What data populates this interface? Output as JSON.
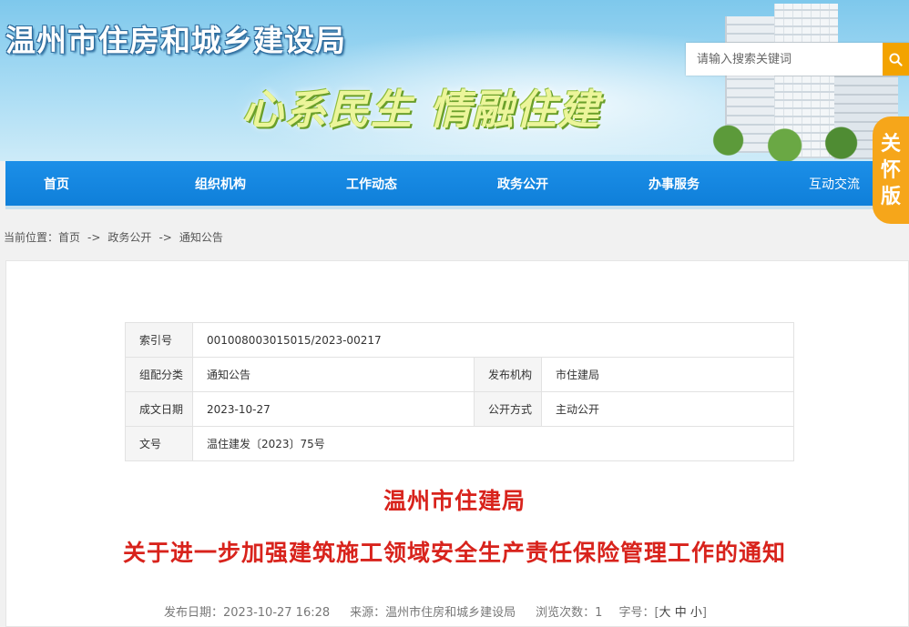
{
  "header": {
    "site_title": "温州市住房和城乡建设局",
    "slogan": "心系民生 情融住建"
  },
  "search": {
    "placeholder": "请输入搜索关键词",
    "button_icon": "search-icon"
  },
  "care_mode": {
    "label_chars": [
      "关",
      "怀",
      "版"
    ]
  },
  "nav": {
    "items": [
      {
        "label": "首页"
      },
      {
        "label": "组织机构"
      },
      {
        "label": "工作动态"
      },
      {
        "label": "政务公开"
      },
      {
        "label": "办事服务"
      },
      {
        "label": "互动交流"
      }
    ]
  },
  "breadcrumb": {
    "prefix": "当前位置：",
    "items": [
      "首页",
      "政务公开",
      "通知公告"
    ],
    "separator": "->"
  },
  "meta": {
    "index_label": "索引号",
    "index_value": "001008003015015/2023-00217",
    "category_label": "组配分类",
    "category_value": "通知公告",
    "publisher_label": "发布机构",
    "publisher_value": "市住建局",
    "date_label": "成文日期",
    "date_value": "2023-10-27",
    "open_label": "公开方式",
    "open_value": "主动公开",
    "docno_label": "文号",
    "docno_value": "温住建发〔2023〕75号"
  },
  "article": {
    "title_line1": "温州市住建局",
    "title_line2": "关于进一步加强建筑施工领域安全生产责任保险管理工作的通知",
    "publish_date": "发布日期：2023-10-27 16:28",
    "source": "来源：温州市住房和城乡建设局",
    "views": "浏览次数：1",
    "font_size_label": "字号：[",
    "font_size_large": "大",
    "font_size_medium": "中",
    "font_size_small": "小",
    "font_size_close": "]"
  },
  "colors": {
    "nav_blue": "#1284e0",
    "title_red": "#d8231c",
    "accent_orange": "#f3a300"
  }
}
